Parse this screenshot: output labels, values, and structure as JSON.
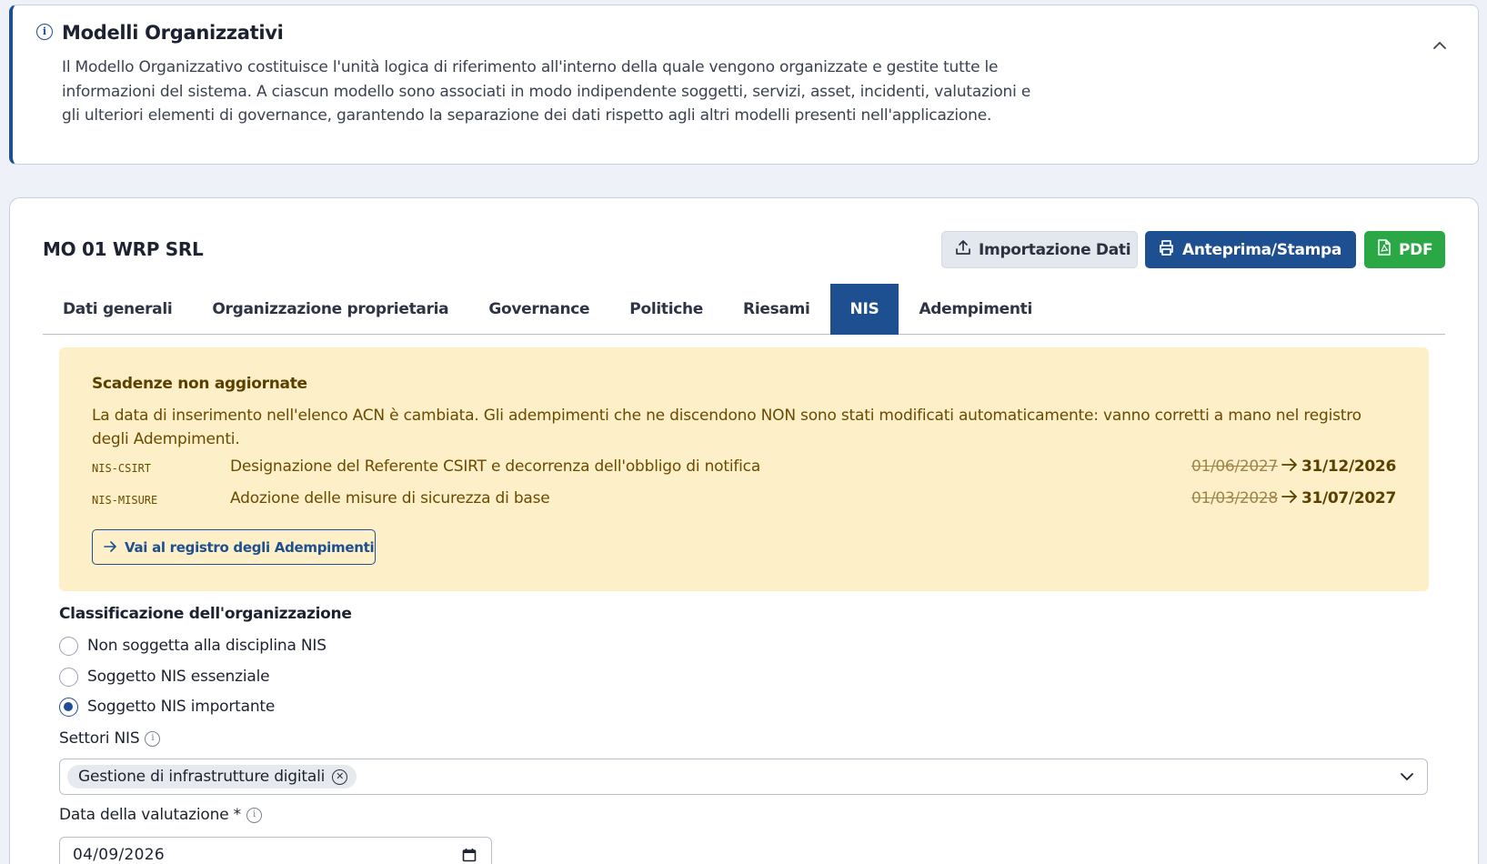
{
  "info": {
    "icon": "info-circle-icon",
    "title": "Modelli Organizzativi",
    "text": "Il Modello Organizzativo costituisce l'unità logica di riferimento all'interno della quale vengono organizzate e gestite tutte le informazioni del sistema. A ciascun modello sono associati in modo indipendente soggetti, servizi, asset, incidenti, valutazioni e gli ulteriori elementi di governance, garantendo la separazione dei dati rispetto agli altri modelli presenti nell'applicazione."
  },
  "card": {
    "title": "MO 01 WRP SRL",
    "buttons": {
      "import_label": "Importazione Dati",
      "print_label": "Anteprima/Stampa",
      "pdf_label": "PDF"
    },
    "tabs": [
      {
        "label": "Dati generali"
      },
      {
        "label": "Organizzazione proprietaria"
      },
      {
        "label": "Governance"
      },
      {
        "label": "Politiche"
      },
      {
        "label": "Riesami"
      },
      {
        "label": "NIS",
        "active": true
      },
      {
        "label": "Adempimenti"
      }
    ]
  },
  "warning": {
    "title": "Scadenze non aggiornate",
    "text": "La data di inserimento nell'elenco ACN è cambiata. Gli adempimenti che ne discendono NON sono stati modificati automaticamente: vanno corretti a mano nel registro degli Adempimenti.",
    "rows": [
      {
        "code": "NIS-CSIRT",
        "description": "Designazione del Referente CSIRT e decorrenza dell'obbligo di notifica",
        "old_date": "01/06/2027",
        "new_date": "31/12/2026"
      },
      {
        "code": "NIS-MISURE",
        "description": "Adozione delle misure di sicurezza di base",
        "old_date": "01/03/2028",
        "new_date": "31/07/2027"
      }
    ],
    "link_label": "Vai al registro degli Adempimenti"
  },
  "classification": {
    "label": "Classificazione dell'organizzazione",
    "options": [
      {
        "label": "Non soggetta alla disciplina NIS",
        "checked": false
      },
      {
        "label": "Soggetto NIS essenziale",
        "checked": false
      },
      {
        "label": "Soggetto NIS importante",
        "checked": true
      }
    ]
  },
  "sectors": {
    "label": "Settori NIS",
    "selected": [
      "Gestione di infrastrutture digitali"
    ]
  },
  "evaluation_date": {
    "label": "Data della valutazione *",
    "value": "04/09/2026"
  },
  "colors": {
    "primary": "#1d4f91",
    "success": "#2aa845",
    "warning_bg": "#fdefc8",
    "warning_text": "#6a4b00"
  }
}
